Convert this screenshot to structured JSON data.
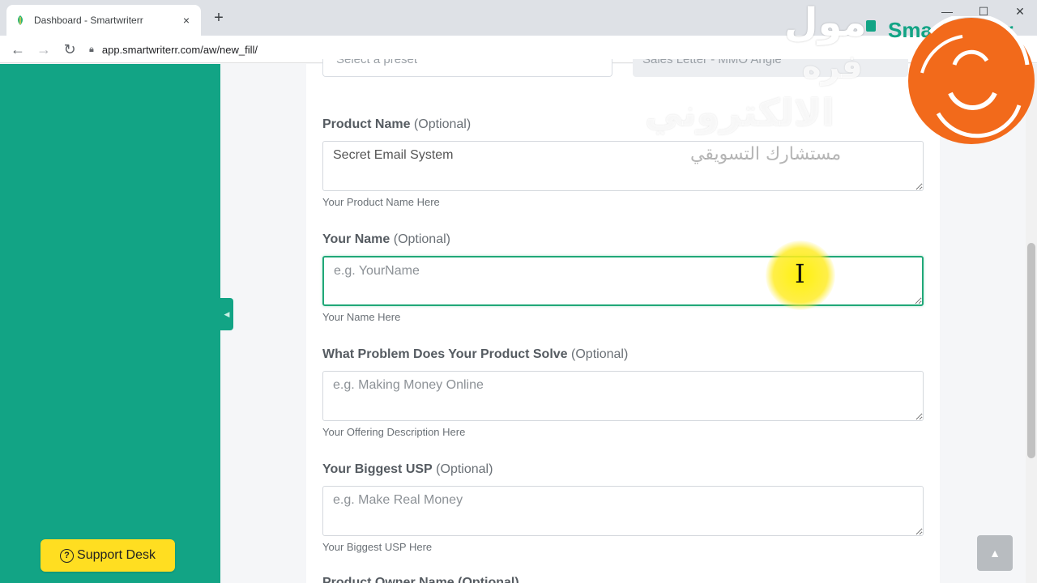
{
  "browser": {
    "tab_title": "Dashboard - Smartwriterr",
    "url": "app.smartwriterr.com/aw/new_fill/",
    "new_tab": "+",
    "close_tab": "×",
    "back": "←",
    "forward": "→",
    "reload": "↻",
    "minimize": "—",
    "maximize": "☐",
    "close_window": "✕"
  },
  "brand": {
    "name": "Smartwriterr"
  },
  "preset": {
    "left_value": "Select a preset",
    "right_value": "Sales Letter - MMO Angle"
  },
  "form": {
    "fields": [
      {
        "label": "Product Name",
        "optional": "(Optional)",
        "value": "Secret Email System",
        "placeholder": "",
        "help": "Your Product Name Here"
      },
      {
        "label": "Your Name",
        "optional": "(Optional)",
        "value": "",
        "placeholder": "e.g. YourName",
        "help": "Your Name Here"
      },
      {
        "label": "What Problem Does Your Product Solve",
        "optional": "(Optional)",
        "value": "",
        "placeholder": "e.g. Making Money Online",
        "help": "Your Offering Description Here"
      },
      {
        "label": "Your Biggest USP",
        "optional": "(Optional)",
        "value": "",
        "placeholder": "e.g. Make Real Money",
        "help": "Your Biggest USP Here"
      }
    ],
    "next_field_label": "Product Owner Name (Optional)"
  },
  "support": {
    "label": "Support Desk",
    "icon": "?"
  },
  "scroll_top": {
    "icon": "▲"
  },
  "watermark": {
    "line1": "مول",
    "line2": "فره",
    "line3": "الالكتروني",
    "line4": "مستشارك التسويقي"
  },
  "colors": {
    "accent": "#12a485",
    "support": "#ffde21",
    "focus": "#20a878"
  }
}
